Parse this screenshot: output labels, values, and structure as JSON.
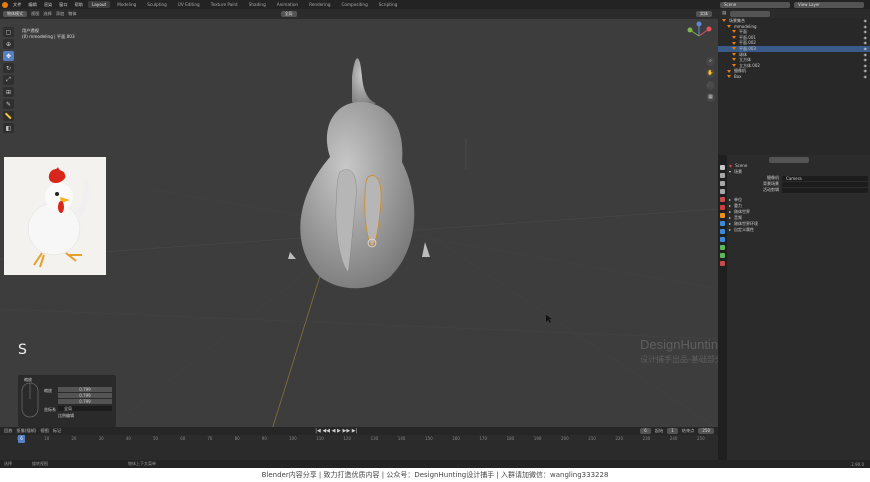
{
  "app": {
    "menus": [
      "文件",
      "编辑",
      "渲染",
      "窗口",
      "帮助"
    ],
    "workspace_tabs": [
      "Layout",
      "Modeling",
      "Sculpting",
      "UV Editing",
      "Texture Paint",
      "Shading",
      "Animation",
      "Rendering",
      "Compositing",
      "Scripting"
    ],
    "active_tab": "Layout",
    "scene": "Scene",
    "view_layer": "View Layer"
  },
  "viewport": {
    "mode_label": "物体模式",
    "header_menus": [
      "视图",
      "选择",
      "添加",
      "物体"
    ],
    "transform_orientation": "全局",
    "shading": "实体",
    "mode_info_title": "用户透视",
    "mode_info_sub": "(0) mmodeling | 平面.003",
    "key_indicator": "S",
    "operator_panel": {
      "title": "缩放",
      "scale_label": "缩放",
      "scale_values": [
        "0.799",
        "0.799",
        "0.799"
      ],
      "orient_label": "坐标系",
      "orient_value": "全局",
      "proportional_label": "比例编辑"
    },
    "watermark_title": "DesignHunting",
    "watermark_subtitle": "设计捕手出品-基础部分"
  },
  "timeline": {
    "menus": [
      "回放",
      "抠像(插帧)",
      "视图",
      "标记"
    ],
    "current_frame": "6",
    "start_label": "起始",
    "start": "1",
    "end_label": "结束点",
    "end": "250",
    "ruler_marks": [
      "0",
      "10",
      "20",
      "30",
      "40",
      "50",
      "60",
      "70",
      "80",
      "90",
      "100",
      "110",
      "120",
      "130",
      "140",
      "150",
      "160",
      "170",
      "180",
      "190",
      "200",
      "210",
      "220",
      "230",
      "240",
      "250"
    ]
  },
  "statusbar": {
    "left": "选择",
    "middle": "旋转视图",
    "right": "物体上下文菜单",
    "version": "2.90.0"
  },
  "bottom_banner": "Blender内容分享  |  致力打造优质内容  |  公众号：DesignHunting设计捕手  |  入群请加微信：wangling333228",
  "outliner": {
    "header": "场景集合",
    "rows": [
      {
        "label": "场景集合",
        "indent": 0
      },
      {
        "label": "mmodeling",
        "indent": 1
      },
      {
        "label": "平面",
        "indent": 2
      },
      {
        "label": "平面.001",
        "indent": 2
      },
      {
        "label": "平面.002",
        "indent": 2
      },
      {
        "label": "平面.003",
        "indent": 2,
        "selected": true
      },
      {
        "label": "球体",
        "indent": 2
      },
      {
        "label": "立方体",
        "indent": 2
      },
      {
        "label": "立方体.002",
        "indent": 2
      },
      {
        "label": "摄像机",
        "indent": 1
      },
      {
        "label": "Box",
        "indent": 1
      }
    ]
  },
  "properties": {
    "scene_name": "Scene",
    "section_title": "场景",
    "camera_label": "摄像机",
    "camera_value": "Camera",
    "bg_scene_label": "背景场景",
    "active_clip_label": "活动剪辑",
    "panels": [
      "单位",
      "重力",
      "刚体世界",
      "音频",
      "刚体世界环境",
      "自定义属性"
    ]
  },
  "colors": {
    "accent": "#e87d0d",
    "selection": "#5680c2",
    "viewport_bg": "#3d3d3d"
  }
}
